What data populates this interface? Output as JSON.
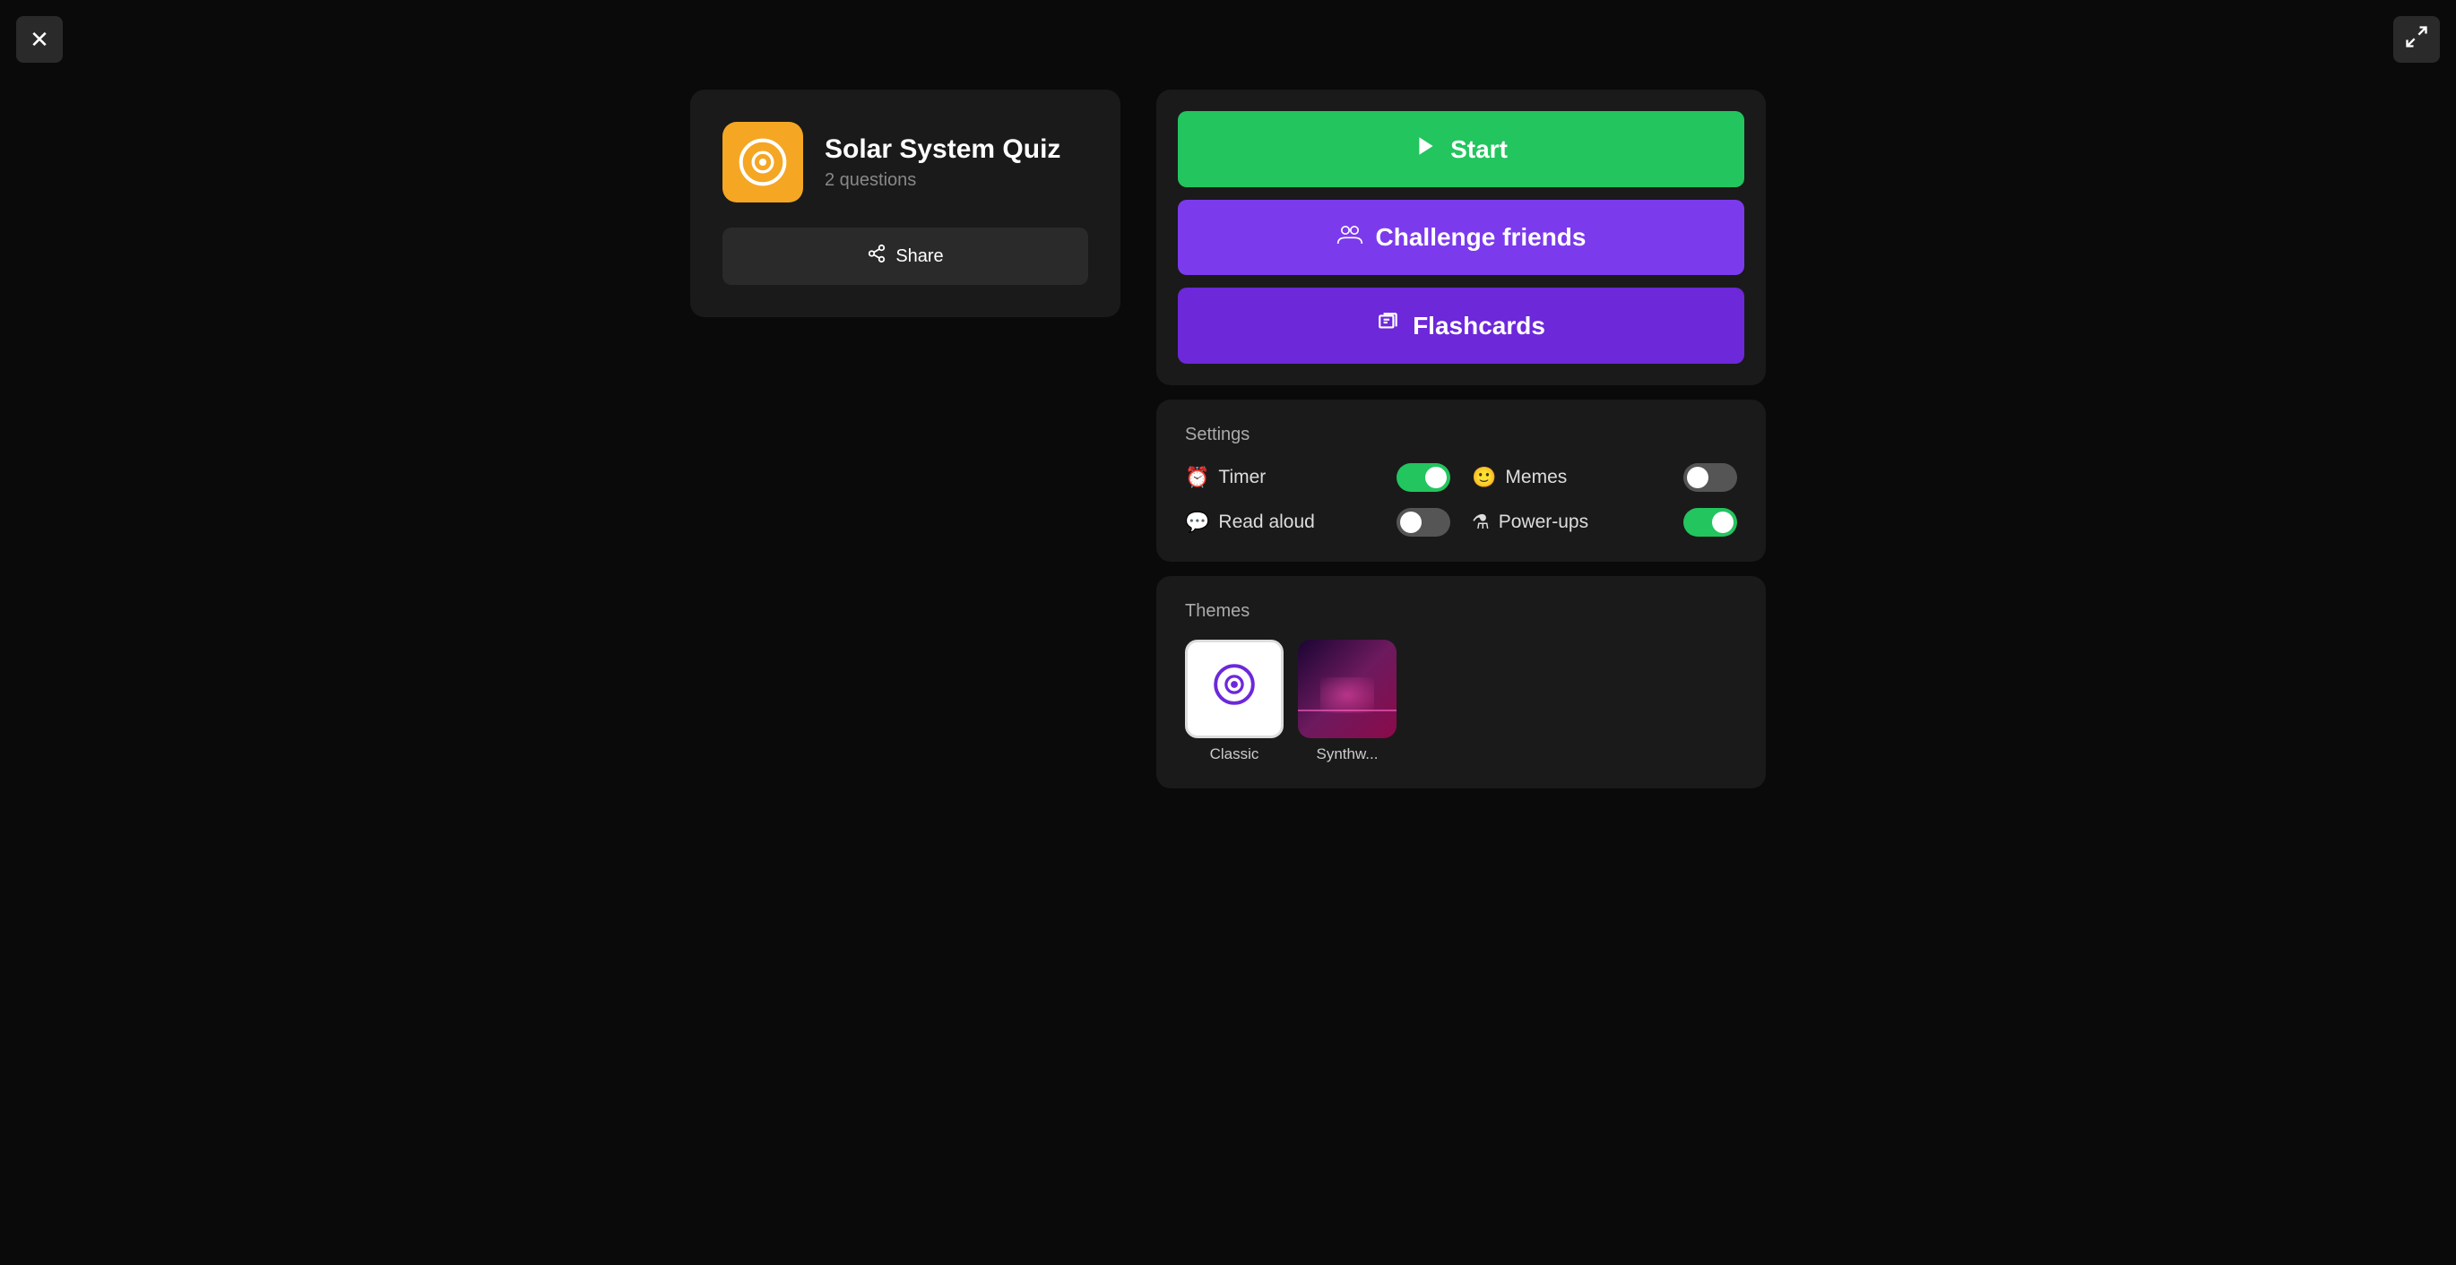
{
  "window": {
    "close_label": "✕",
    "fullscreen_label": "⛶"
  },
  "quiz_card": {
    "icon_symbol": "Q",
    "title": "Solar System Quiz",
    "subtitle": "2 questions",
    "share_label": "Share",
    "share_icon": "◄"
  },
  "action_buttons": {
    "start_label": "Start",
    "start_icon": "▶",
    "challenge_label": "Challenge friends",
    "challenge_icon": "👥",
    "flashcards_label": "Flashcards",
    "flashcards_icon": "🗗"
  },
  "settings": {
    "title": "Settings",
    "items": [
      {
        "id": "timer",
        "label": "Timer",
        "icon": "⏰",
        "state": "on"
      },
      {
        "id": "memes",
        "label": "Memes",
        "icon": "🙂",
        "state": "off"
      },
      {
        "id": "read_aloud",
        "label": "Read aloud",
        "icon": "💬",
        "state": "off"
      },
      {
        "id": "power_ups",
        "label": "Power-ups",
        "icon": "⚗",
        "state": "on"
      }
    ]
  },
  "themes": {
    "title": "Themes",
    "items": [
      {
        "id": "classic",
        "label": "Classic"
      },
      {
        "id": "synthwave",
        "label": "Synthw..."
      }
    ]
  },
  "colors": {
    "green": "#22c55e",
    "purple_dark": "#7c3aed",
    "purple_medium": "#6d28d9",
    "orange": "#f5a623",
    "bg_card": "#1a1a1a",
    "bg_app": "#0a0a0a"
  }
}
